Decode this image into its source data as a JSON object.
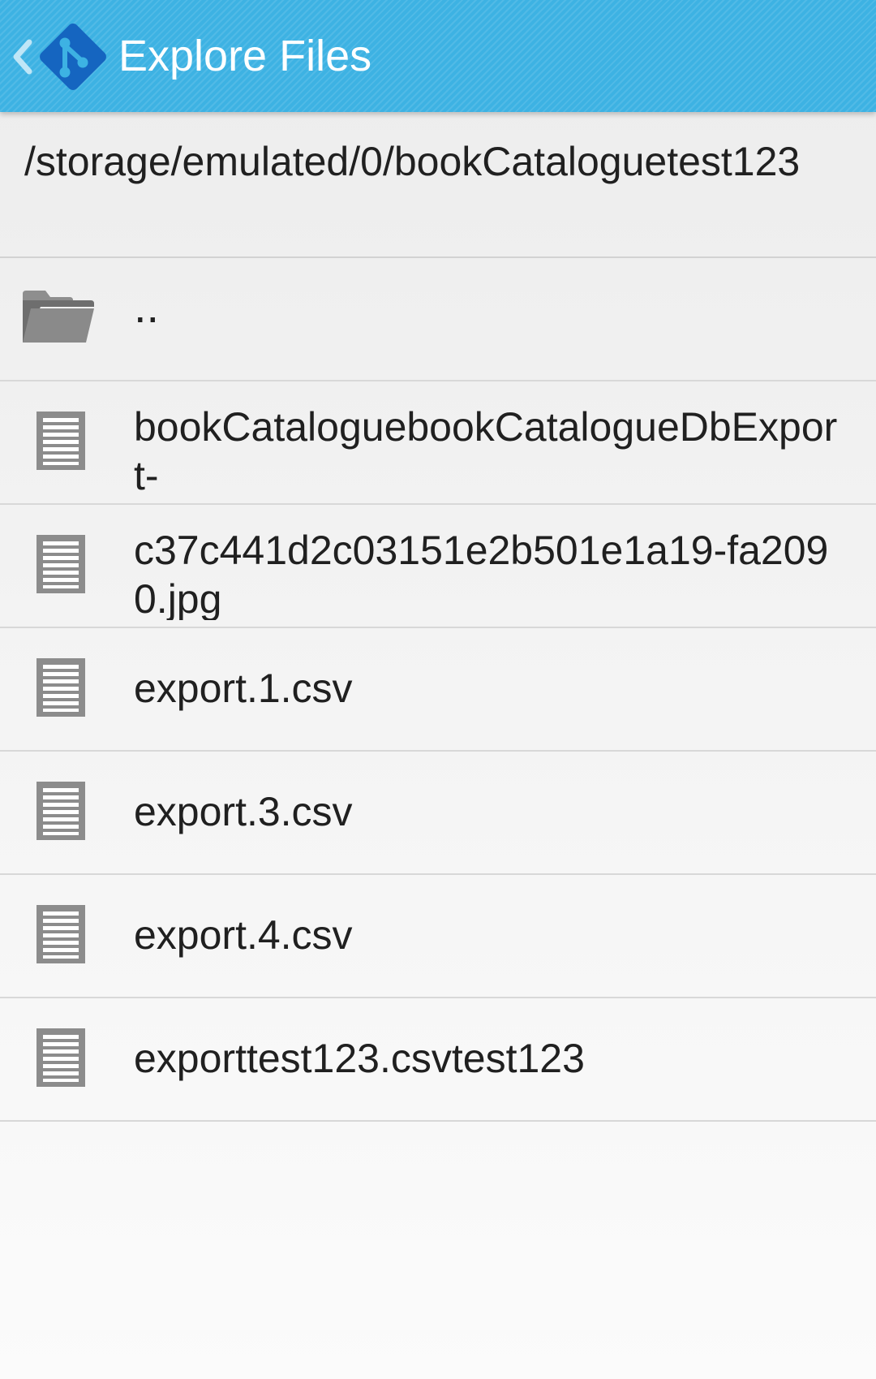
{
  "appbar": {
    "title": "Explore Files",
    "background_color": "#3db2e3",
    "nav_icon": "chevron-left-icon",
    "logo_icon": "git-logo-icon"
  },
  "current_path": "/storage/emulated/0/bookCataloguetest123",
  "entries": [
    {
      "name": "..",
      "icon": "folder-icon"
    },
    {
      "name": "bookCataloguebookCatalogueDbExport-",
      "icon": "document-icon"
    },
    {
      "name": "c37c441d2c03151e2b501e1a19-fa2090.jpg",
      "icon": "document-icon"
    },
    {
      "name": "export.1.csv",
      "icon": "document-icon"
    },
    {
      "name": "export.3.csv",
      "icon": "document-icon"
    },
    {
      "name": "export.4.csv",
      "icon": "document-icon"
    },
    {
      "name": "exporttest123.csvtest123",
      "icon": "document-icon"
    }
  ]
}
